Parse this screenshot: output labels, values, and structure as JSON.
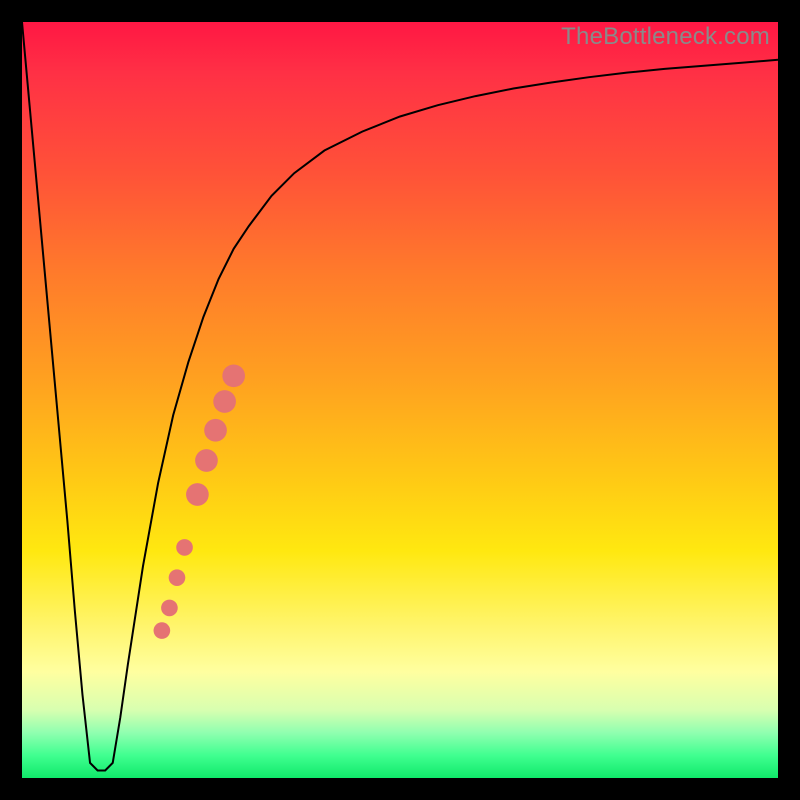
{
  "watermark": "TheBottleneck.com",
  "chart_data": {
    "type": "line",
    "title": "",
    "xlabel": "",
    "ylabel": "",
    "xlim": [
      0,
      100
    ],
    "ylim": [
      0,
      100
    ],
    "x": [
      0,
      1,
      2,
      3,
      4,
      5,
      6,
      7,
      8,
      9,
      10,
      11,
      12,
      13,
      14,
      16,
      18,
      20,
      22,
      24,
      26,
      28,
      30,
      33,
      36,
      40,
      45,
      50,
      55,
      60,
      65,
      70,
      75,
      80,
      85,
      90,
      95,
      100
    ],
    "values": [
      100,
      89,
      78,
      67,
      56,
      45,
      34,
      22,
      11,
      2,
      1,
      1,
      2,
      8,
      15,
      28,
      39,
      48,
      55,
      61,
      66,
      70,
      73,
      77,
      80,
      83,
      85.5,
      87.5,
      89,
      90.2,
      91.2,
      92,
      92.7,
      93.3,
      93.8,
      94.2,
      94.6,
      95
    ],
    "markers": [
      {
        "x": 18.5,
        "y": 19.5,
        "r": 1.1
      },
      {
        "x": 19.5,
        "y": 22.5,
        "r": 1.1
      },
      {
        "x": 20.5,
        "y": 26.5,
        "r": 1.1
      },
      {
        "x": 21.5,
        "y": 30.5,
        "r": 1.1
      },
      {
        "x": 23.2,
        "y": 37.5,
        "r": 1.5
      },
      {
        "x": 24.4,
        "y": 42.0,
        "r": 1.5
      },
      {
        "x": 25.6,
        "y": 46.0,
        "r": 1.5
      },
      {
        "x": 26.8,
        "y": 49.8,
        "r": 1.5
      },
      {
        "x": 28.0,
        "y": 53.2,
        "r": 1.5
      }
    ],
    "colors": {
      "line": "#000000",
      "marker": "#e57373"
    }
  }
}
